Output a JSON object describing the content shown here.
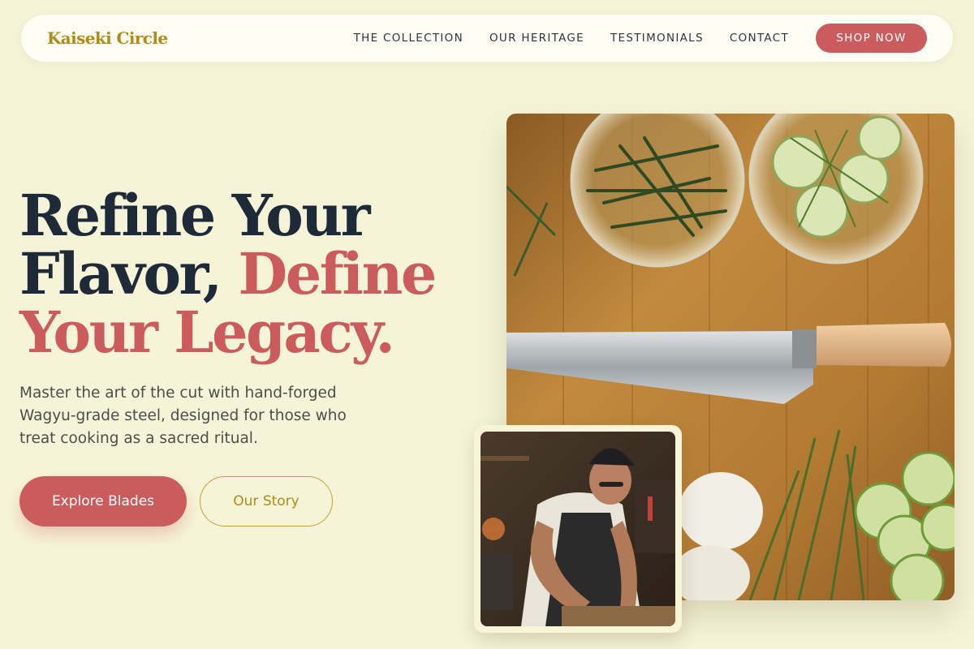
{
  "nav": {
    "brand": "Kaiseki Circle",
    "links": [
      "THE COLLECTION",
      "OUR HERITAGE",
      "TESTIMONIALS",
      "CONTACT"
    ],
    "cta": "SHOP NOW"
  },
  "hero": {
    "headline_1": "Refine Your",
    "headline_2": "Flavor, ",
    "headline_accent_1": "Define",
    "headline_accent_2": "Your Legacy.",
    "subtext": "Master the art of the cut with hand-forged Wagyu-grade steel, designed for those who treat cooking as a sacred ritual.",
    "primary_button": "Explore Blades",
    "secondary_button": "Our Story"
  },
  "images": {
    "main": "knife-on-cutting-board-with-herbs-photo",
    "secondary": "chef-slicing-in-kitchen-photo"
  },
  "colors": {
    "background": "#f6f4d8",
    "accent": "#cc5b5e",
    "gold": "#b08a1a",
    "ink": "#1f2a38"
  }
}
